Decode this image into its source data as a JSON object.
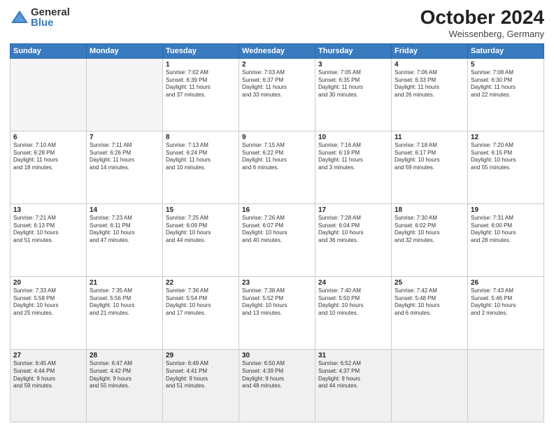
{
  "logo": {
    "general": "General",
    "blue": "Blue"
  },
  "title": "October 2024",
  "location": "Weissenberg, Germany",
  "days_header": [
    "Sunday",
    "Monday",
    "Tuesday",
    "Wednesday",
    "Thursday",
    "Friday",
    "Saturday"
  ],
  "weeks": [
    [
      {
        "day": "",
        "info": ""
      },
      {
        "day": "",
        "info": ""
      },
      {
        "day": "1",
        "info": "Sunrise: 7:02 AM\nSunset: 6:39 PM\nDaylight: 11 hours\nand 37 minutes."
      },
      {
        "day": "2",
        "info": "Sunrise: 7:03 AM\nSunset: 6:37 PM\nDaylight: 11 hours\nand 33 minutes."
      },
      {
        "day": "3",
        "info": "Sunrise: 7:05 AM\nSunset: 6:35 PM\nDaylight: 11 hours\nand 30 minutes."
      },
      {
        "day": "4",
        "info": "Sunrise: 7:06 AM\nSunset: 6:33 PM\nDaylight: 11 hours\nand 26 minutes."
      },
      {
        "day": "5",
        "info": "Sunrise: 7:08 AM\nSunset: 6:30 PM\nDaylight: 11 hours\nand 22 minutes."
      }
    ],
    [
      {
        "day": "6",
        "info": "Sunrise: 7:10 AM\nSunset: 6:28 PM\nDaylight: 11 hours\nand 18 minutes."
      },
      {
        "day": "7",
        "info": "Sunrise: 7:11 AM\nSunset: 6:26 PM\nDaylight: 11 hours\nand 14 minutes."
      },
      {
        "day": "8",
        "info": "Sunrise: 7:13 AM\nSunset: 6:24 PM\nDaylight: 11 hours\nand 10 minutes."
      },
      {
        "day": "9",
        "info": "Sunrise: 7:15 AM\nSunset: 6:22 PM\nDaylight: 11 hours\nand 6 minutes."
      },
      {
        "day": "10",
        "info": "Sunrise: 7:16 AM\nSunset: 6:19 PM\nDaylight: 11 hours\nand 3 minutes."
      },
      {
        "day": "11",
        "info": "Sunrise: 7:18 AM\nSunset: 6:17 PM\nDaylight: 10 hours\nand 59 minutes."
      },
      {
        "day": "12",
        "info": "Sunrise: 7:20 AM\nSunset: 6:15 PM\nDaylight: 10 hours\nand 55 minutes."
      }
    ],
    [
      {
        "day": "13",
        "info": "Sunrise: 7:21 AM\nSunset: 6:13 PM\nDaylight: 10 hours\nand 51 minutes."
      },
      {
        "day": "14",
        "info": "Sunrise: 7:23 AM\nSunset: 6:11 PM\nDaylight: 10 hours\nand 47 minutes."
      },
      {
        "day": "15",
        "info": "Sunrise: 7:25 AM\nSunset: 6:09 PM\nDaylight: 10 hours\nand 44 minutes."
      },
      {
        "day": "16",
        "info": "Sunrise: 7:26 AM\nSunset: 6:07 PM\nDaylight: 10 hours\nand 40 minutes."
      },
      {
        "day": "17",
        "info": "Sunrise: 7:28 AM\nSunset: 6:04 PM\nDaylight: 10 hours\nand 36 minutes."
      },
      {
        "day": "18",
        "info": "Sunrise: 7:30 AM\nSunset: 6:02 PM\nDaylight: 10 hours\nand 32 minutes."
      },
      {
        "day": "19",
        "info": "Sunrise: 7:31 AM\nSunset: 6:00 PM\nDaylight: 10 hours\nand 28 minutes."
      }
    ],
    [
      {
        "day": "20",
        "info": "Sunrise: 7:33 AM\nSunset: 5:58 PM\nDaylight: 10 hours\nand 25 minutes."
      },
      {
        "day": "21",
        "info": "Sunrise: 7:35 AM\nSunset: 5:56 PM\nDaylight: 10 hours\nand 21 minutes."
      },
      {
        "day": "22",
        "info": "Sunrise: 7:36 AM\nSunset: 5:54 PM\nDaylight: 10 hours\nand 17 minutes."
      },
      {
        "day": "23",
        "info": "Sunrise: 7:38 AM\nSunset: 5:52 PM\nDaylight: 10 hours\nand 13 minutes."
      },
      {
        "day": "24",
        "info": "Sunrise: 7:40 AM\nSunset: 5:50 PM\nDaylight: 10 hours\nand 10 minutes."
      },
      {
        "day": "25",
        "info": "Sunrise: 7:42 AM\nSunset: 5:48 PM\nDaylight: 10 hours\nand 6 minutes."
      },
      {
        "day": "26",
        "info": "Sunrise: 7:43 AM\nSunset: 5:46 PM\nDaylight: 10 hours\nand 2 minutes."
      }
    ],
    [
      {
        "day": "27",
        "info": "Sunrise: 6:45 AM\nSunset: 4:44 PM\nDaylight: 9 hours\nand 59 minutes."
      },
      {
        "day": "28",
        "info": "Sunrise: 6:47 AM\nSunset: 4:42 PM\nDaylight: 9 hours\nand 55 minutes."
      },
      {
        "day": "29",
        "info": "Sunrise: 6:49 AM\nSunset: 4:41 PM\nDaylight: 9 hours\nand 51 minutes."
      },
      {
        "day": "30",
        "info": "Sunrise: 6:50 AM\nSunset: 4:39 PM\nDaylight: 9 hours\nand 48 minutes."
      },
      {
        "day": "31",
        "info": "Sunrise: 6:52 AM\nSunset: 4:37 PM\nDaylight: 9 hours\nand 44 minutes."
      },
      {
        "day": "",
        "info": ""
      },
      {
        "day": "",
        "info": ""
      }
    ]
  ]
}
